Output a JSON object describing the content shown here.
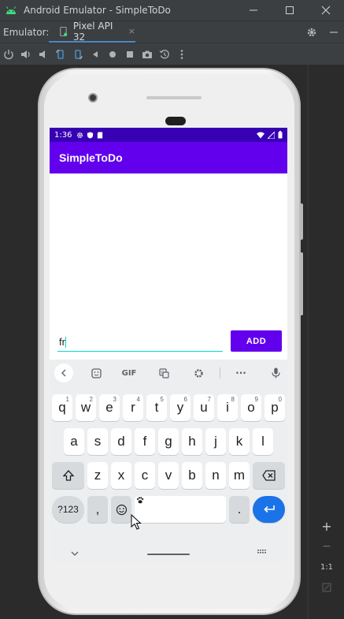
{
  "window": {
    "title": "Android Emulator - SimpleToDo",
    "tab_label": "Emulator:",
    "device_tab": "Pixel API 32",
    "device_tab_close": "×"
  },
  "side_panel": {
    "zoom_in": "+",
    "zoom_out": "−",
    "one_to_one": "1:1"
  },
  "status_bar": {
    "time": "1:36"
  },
  "app": {
    "title": "SimpleToDo",
    "input_value": "fr",
    "add_label": "ADD"
  },
  "keyboard": {
    "toolbar": {
      "gif": "GIF",
      "more": "···"
    },
    "row1": [
      {
        "key": "q",
        "hint": "1"
      },
      {
        "key": "w",
        "hint": "2"
      },
      {
        "key": "e",
        "hint": "3"
      },
      {
        "key": "r",
        "hint": "4"
      },
      {
        "key": "t",
        "hint": "5"
      },
      {
        "key": "y",
        "hint": "6"
      },
      {
        "key": "u",
        "hint": "7"
      },
      {
        "key": "i",
        "hint": "8"
      },
      {
        "key": "o",
        "hint": "9"
      },
      {
        "key": "p",
        "hint": "0"
      }
    ],
    "row2": [
      "a",
      "s",
      "d",
      "f",
      "g",
      "h",
      "j",
      "k",
      "l"
    ],
    "row3": [
      "z",
      "x",
      "c",
      "v",
      "b",
      "n",
      "m"
    ],
    "symbols": "?123",
    "comma": ",",
    "period": "."
  },
  "colors": {
    "status_bar": "#3700b3",
    "app_bar": "#6200ee",
    "accent": "#03dac5",
    "enter_key": "#1a73e8"
  }
}
